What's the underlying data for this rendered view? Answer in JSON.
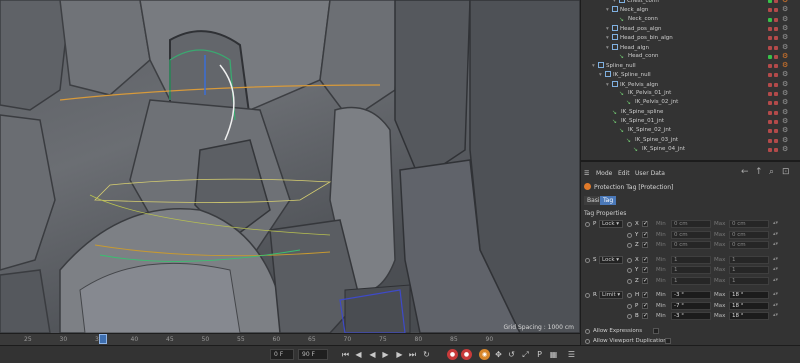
{
  "viewport": {
    "grid_spacing": "Grid Spacing : 1000 cm"
  },
  "timeline": {
    "ticks": [
      "25",
      "30",
      "35",
      "40",
      "45",
      "50",
      "55",
      "60",
      "65",
      "70",
      "75",
      "80",
      "85",
      "90"
    ],
    "frame_field": "90 F",
    "end_field": "0 F"
  },
  "object_manager": {
    "rows": [
      {
        "label": "Chest_conn",
        "indent": 4,
        "icon": "null",
        "partial": true
      },
      {
        "label": "Neck_algn",
        "indent": 3,
        "icon": "null"
      },
      {
        "label": "Neck_conn",
        "indent": 4,
        "icon": "joint"
      },
      {
        "label": "Head_pos_algn",
        "indent": 3,
        "icon": "null"
      },
      {
        "label": "Head_pos_bin_algn",
        "indent": 3,
        "icon": "null"
      },
      {
        "label": "Head_algn",
        "indent": 3,
        "icon": "null"
      },
      {
        "label": "Head_conn",
        "indent": 4,
        "icon": "joint"
      },
      {
        "label": "Spline_null",
        "indent": 1,
        "icon": "null"
      },
      {
        "label": "IK_Spline_null",
        "indent": 2,
        "icon": "null"
      },
      {
        "label": "IK_Pelvis_algn",
        "indent": 3,
        "icon": "null"
      },
      {
        "label": "IK_Pelvis_01_jnt",
        "indent": 4,
        "icon": "joint"
      },
      {
        "label": "IK_Pelvis_02_jnt",
        "indent": 5,
        "icon": "joint"
      },
      {
        "label": "IK_Spine_spline",
        "indent": 3,
        "icon": "joint"
      },
      {
        "label": "IK_Spine_01_jnt",
        "indent": 3,
        "icon": "joint"
      },
      {
        "label": "IK_Spine_02_jnt",
        "indent": 4,
        "icon": "joint"
      },
      {
        "label": "IK_Spine_03_jnt",
        "indent": 5,
        "icon": "joint"
      },
      {
        "label": "IK_Spine_04_jnt",
        "indent": 6,
        "icon": "joint"
      }
    ]
  },
  "attribute_manager": {
    "menu": [
      "Mode",
      "Edit",
      "User Data"
    ],
    "title": "Protection Tag [Protection]",
    "tabs": [
      "Basic",
      "Tag"
    ],
    "section": "Tag Properties",
    "groups": [
      {
        "axis": "P",
        "mode": "Lock",
        "rows": [
          {
            "sub": "X",
            "min": "0 cm",
            "max": "0 cm"
          },
          {
            "sub": "Y",
            "min": "0 cm",
            "max": "0 cm"
          },
          {
            "sub": "Z",
            "min": "0 cm",
            "max": "0 cm"
          }
        ]
      },
      {
        "axis": "S",
        "mode": "Lock",
        "rows": [
          {
            "sub": "X",
            "min": "1",
            "max": "1"
          },
          {
            "sub": "Y",
            "min": "1",
            "max": "1"
          },
          {
            "sub": "Z",
            "min": "1",
            "max": "1"
          }
        ]
      },
      {
        "axis": "R",
        "mode": "Limit",
        "rows": [
          {
            "sub": "H",
            "min": "-3 °",
            "max": "18 °"
          },
          {
            "sub": "P",
            "min": "-7 °",
            "max": "18 °"
          },
          {
            "sub": "B",
            "min": "-3 °",
            "max": "18 °"
          }
        ]
      }
    ],
    "min_label": "Min",
    "max_label": "Max",
    "options": [
      "Allow Expressions",
      "Allow Viewport Duplication"
    ]
  },
  "colors": {
    "accent": "#4a78b8",
    "tag_orange": "#e07a2a",
    "flag_green": "#38c24a",
    "flag_red": "#b34a4a"
  }
}
